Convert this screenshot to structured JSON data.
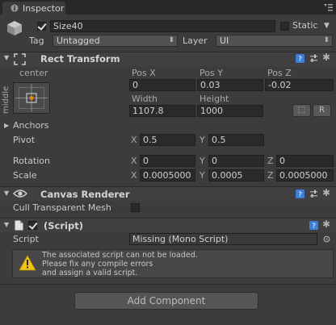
{
  "tab": {
    "label": "Inspector"
  },
  "gameobject": {
    "active": true,
    "name": "Size40",
    "static_label": "Static",
    "static_checked": false,
    "tag_label": "Tag",
    "tag_value": "Untagged",
    "layer_label": "Layer",
    "layer_value": "UI"
  },
  "rect_transform": {
    "title": "Rect Transform",
    "anchor_h": "center",
    "anchor_v": "middle",
    "pos_x_label": "Pos X",
    "pos_y_label": "Pos Y",
    "pos_z_label": "Pos Z",
    "pos_x": "0",
    "pos_y": "0.03",
    "pos_z": "-0.02",
    "width_label": "Width",
    "height_label": "Height",
    "width": "1107.8",
    "height": "1000",
    "blueprint_btn": "⬚",
    "raw_btn": "R",
    "anchors_label": "Anchors",
    "pivot_label": "Pivot",
    "pivot_x": "0.5",
    "pivot_y": "0.5",
    "rotation_label": "Rotation",
    "rot_x": "0",
    "rot_y": "0",
    "rot_z": "0",
    "scale_label": "Scale",
    "scale_x": "0.0005000",
    "scale_y": "0.0005",
    "scale_z": "0.0005000",
    "axis_x": "X",
    "axis_y": "Y",
    "axis_z": "Z"
  },
  "canvas_renderer": {
    "title": "Canvas Renderer",
    "cull_label": "Cull Transparent Mesh",
    "cull_checked": false
  },
  "script_comp": {
    "title": "(Script)",
    "enabled": true,
    "script_label": "Script",
    "script_value": "Missing (Mono Script)",
    "warning_line1": "The associated script can not be loaded.",
    "warning_line2": "Please fix any compile errors",
    "warning_line3": "and assign a valid script."
  },
  "add_component": {
    "label": "Add Component"
  },
  "colors": {
    "accent_blue": "#3d7ed8",
    "warning_yellow": "#f0c419",
    "pivot_orange": "#f08a00"
  }
}
